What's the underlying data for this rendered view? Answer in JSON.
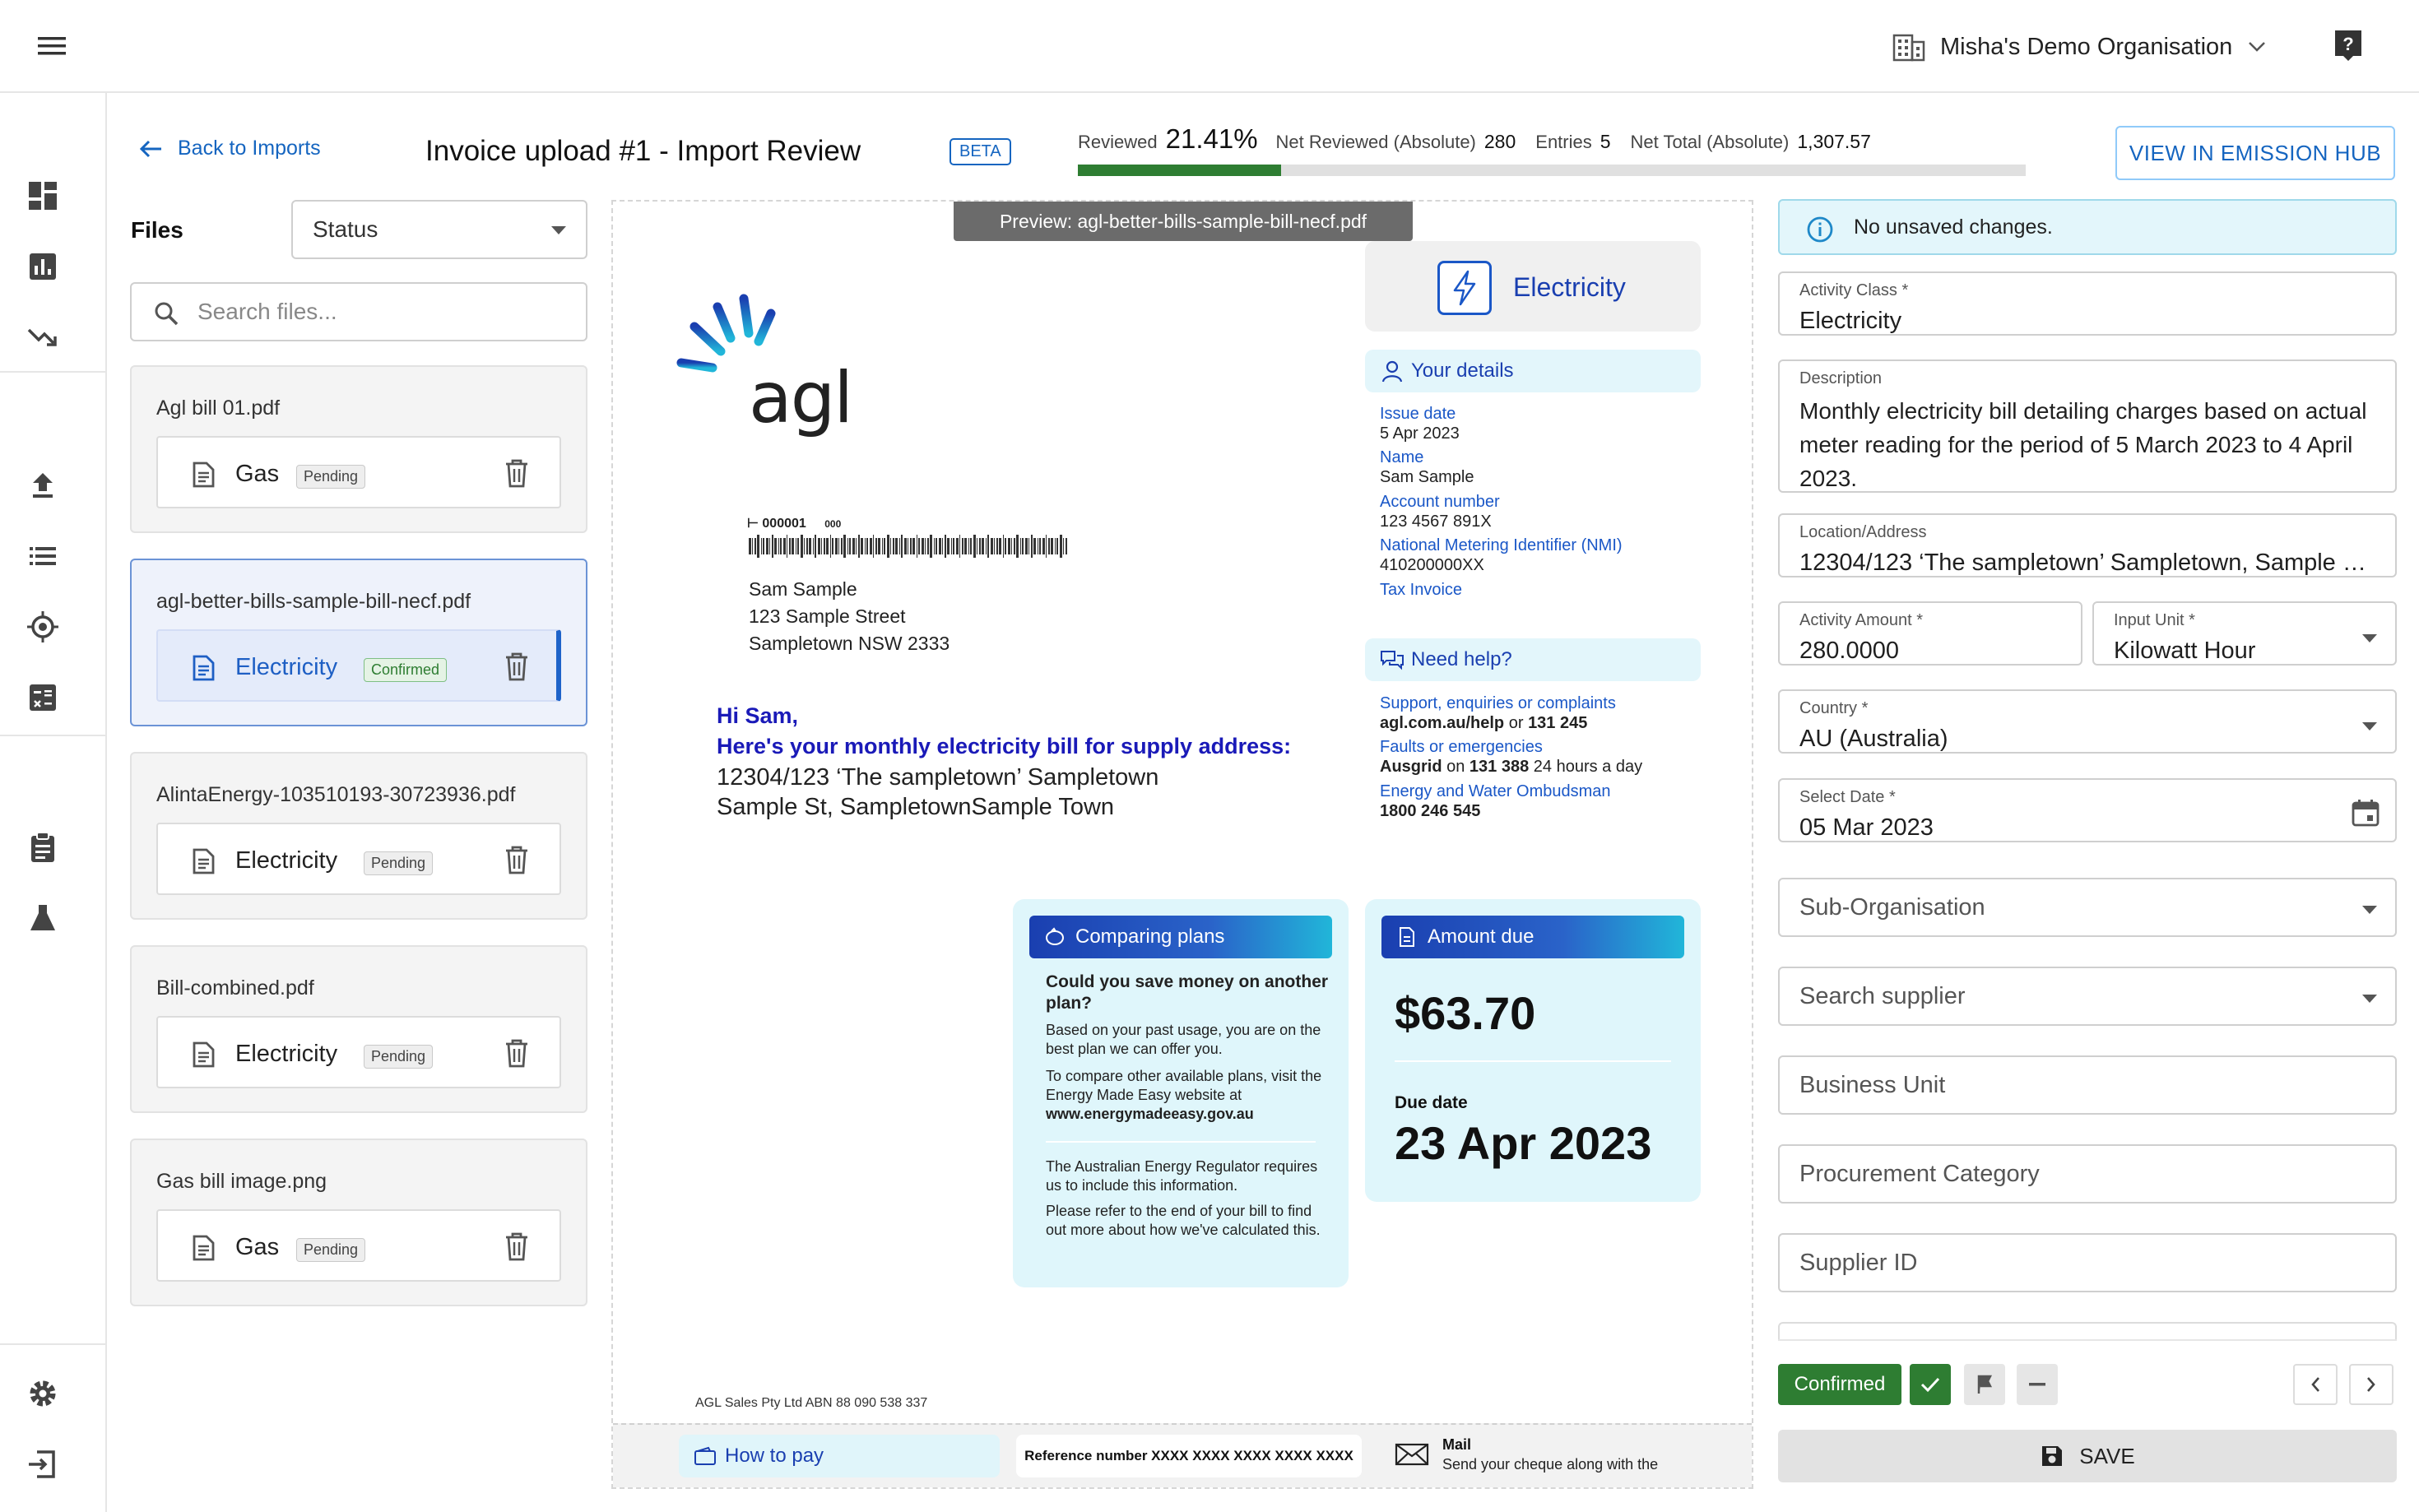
{
  "topbar": {
    "org_name": "Misha's Demo Organisation",
    "menu_icon": "hamburger-icon",
    "help_icon": "help-icon"
  },
  "rail": {
    "icons": [
      "dashboard-icon",
      "bar-chart-icon",
      "trend-down-icon",
      "upload-icon",
      "list-icon",
      "target-icon",
      "calculator-icon",
      "clipboard-icon",
      "flask-icon",
      "settings-icon",
      "logout-icon"
    ]
  },
  "header": {
    "back_label": "Back to Imports",
    "title": "Invoice upload #1 - Import Review",
    "beta": "BETA",
    "reviewed_label": "Reviewed",
    "reviewed_value": "21.41%",
    "reviewed_fraction": 0.2141,
    "net_reviewed_label": "Net Reviewed (Absolute)",
    "net_reviewed_value": "280",
    "entries_label": "Entries",
    "entries_value": "5",
    "net_total_label": "Net Total (Absolute)",
    "net_total_value": "1,307.57",
    "hub_button": "VIEW IN EMISSION HUB"
  },
  "files": {
    "label": "Files",
    "status_filter": "Status",
    "search_placeholder": "Search files...",
    "items": [
      {
        "name": "Agl bill 01.pdf",
        "type": "Gas",
        "status": "Pending"
      },
      {
        "name": "agl-better-bills-sample-bill-necf.pdf",
        "type": "Electricity",
        "status": "Confirmed"
      },
      {
        "name": "AlintaEnergy-103510193-30723936.pdf",
        "type": "Electricity",
        "status": "Pending"
      },
      {
        "name": "Bill-combined.pdf",
        "type": "Electricity",
        "status": "Pending"
      },
      {
        "name": "Gas bill image.png",
        "type": "Gas",
        "status": "Pending"
      }
    ]
  },
  "preview": {
    "tab_label": "Preview: agl-better-bills-sample-bill-necf.pdf",
    "logo_text": "agl",
    "barcode_ref": "000001",
    "barcode_code": "000",
    "recipient": [
      "Sam Sample",
      "123 Sample Street",
      "Sampletown NSW 2333"
    ],
    "service_label": "Electricity",
    "your_details_label": "Your details",
    "details": [
      {
        "label": "Issue date",
        "value": "5 Apr 2023"
      },
      {
        "label": "Name",
        "value": "Sam Sample"
      },
      {
        "label": "Account number",
        "value": "123 4567 891X"
      },
      {
        "label": "National Metering Identifier (NMI)",
        "value": "410200000XX"
      },
      {
        "label": "Tax Invoice",
        "value": ""
      }
    ],
    "need_help_label": "Need help?",
    "help": {
      "support_label": "Support, enquiries or complaints",
      "support_value_bold": "agl.com.au/help",
      "support_or": " or ",
      "support_phone": "131 245",
      "faults_label": "Faults or emergencies",
      "faults_bold": "Ausgrid",
      "faults_on": " on ",
      "faults_phone": "131 388",
      "faults_suffix": " 24 hours a day",
      "ombudsman_label": "Energy and Water Ombudsman",
      "ombudsman_phone": "1800 246 545"
    },
    "greeting": "Hi Sam,",
    "headline": "Here's your monthly electricity bill for supply address:",
    "address_lines": [
      "12304/123 ‘The sampletown’ Sampletown",
      "Sample St, SampletownSample Town"
    ],
    "comparing": {
      "title": "Comparing plans",
      "question": "Could you save money on another plan?",
      "p1": "Based on your past usage, you are on the best plan we can offer you.",
      "p2_start": "To compare other available plans, visit the Energy Made Easy website at ",
      "p2_link": "www.energymadeeasy.gov.au",
      "p3": "The Australian Energy Regulator requires us to include this information.",
      "p4": "Please refer to the end of your bill to find out more about how we've calculated this."
    },
    "amount": {
      "title": "Amount due",
      "value": "$63.70",
      "due_label": "Due date",
      "due_value": "23 Apr 2023"
    },
    "footer_company": "AGL Sales Pty Ltd ABN 88 090 538 337",
    "how_to_pay": "How to pay",
    "reference": "Reference number XXXX XXXX XXXX XXXX XXXX",
    "mail_label": "Mail",
    "mail_text": "Send your cheque along with the"
  },
  "form": {
    "banner": "No unsaved changes.",
    "activity_class_label": "Activity Class *",
    "activity_class_value": "Electricity",
    "description_label": "Description",
    "description_value": "Monthly electricity bill detailing charges based on actual meter reading for the period of 5 March 2023 to 4 April 2023.",
    "location_label": "Location/Address",
    "location_value": "12304/123 ‘The sampletown’ Sampletown, Sample S...",
    "amount_label": "Activity Amount *",
    "amount_value": "280.0000",
    "unit_label": "Input Unit *",
    "unit_value": "Kilowatt Hour",
    "country_label": "Country *",
    "country_value": "AU (Australia)",
    "date_label": "Select Date *",
    "date_value": "05 Mar 2023",
    "sub_org_placeholder": "Sub-Organisation",
    "supplier_placeholder": "Search supplier",
    "business_unit_placeholder": "Business Unit",
    "procurement_placeholder": "Procurement Category",
    "supplier_id_placeholder": "Supplier ID",
    "status_value": "Confirmed",
    "save_label": "SAVE"
  },
  "colors": {
    "accent": "#1565c0",
    "success": "#2e7d32",
    "agl_blue": "#1a3fb0",
    "agl_cyan": "#21b6d9"
  }
}
